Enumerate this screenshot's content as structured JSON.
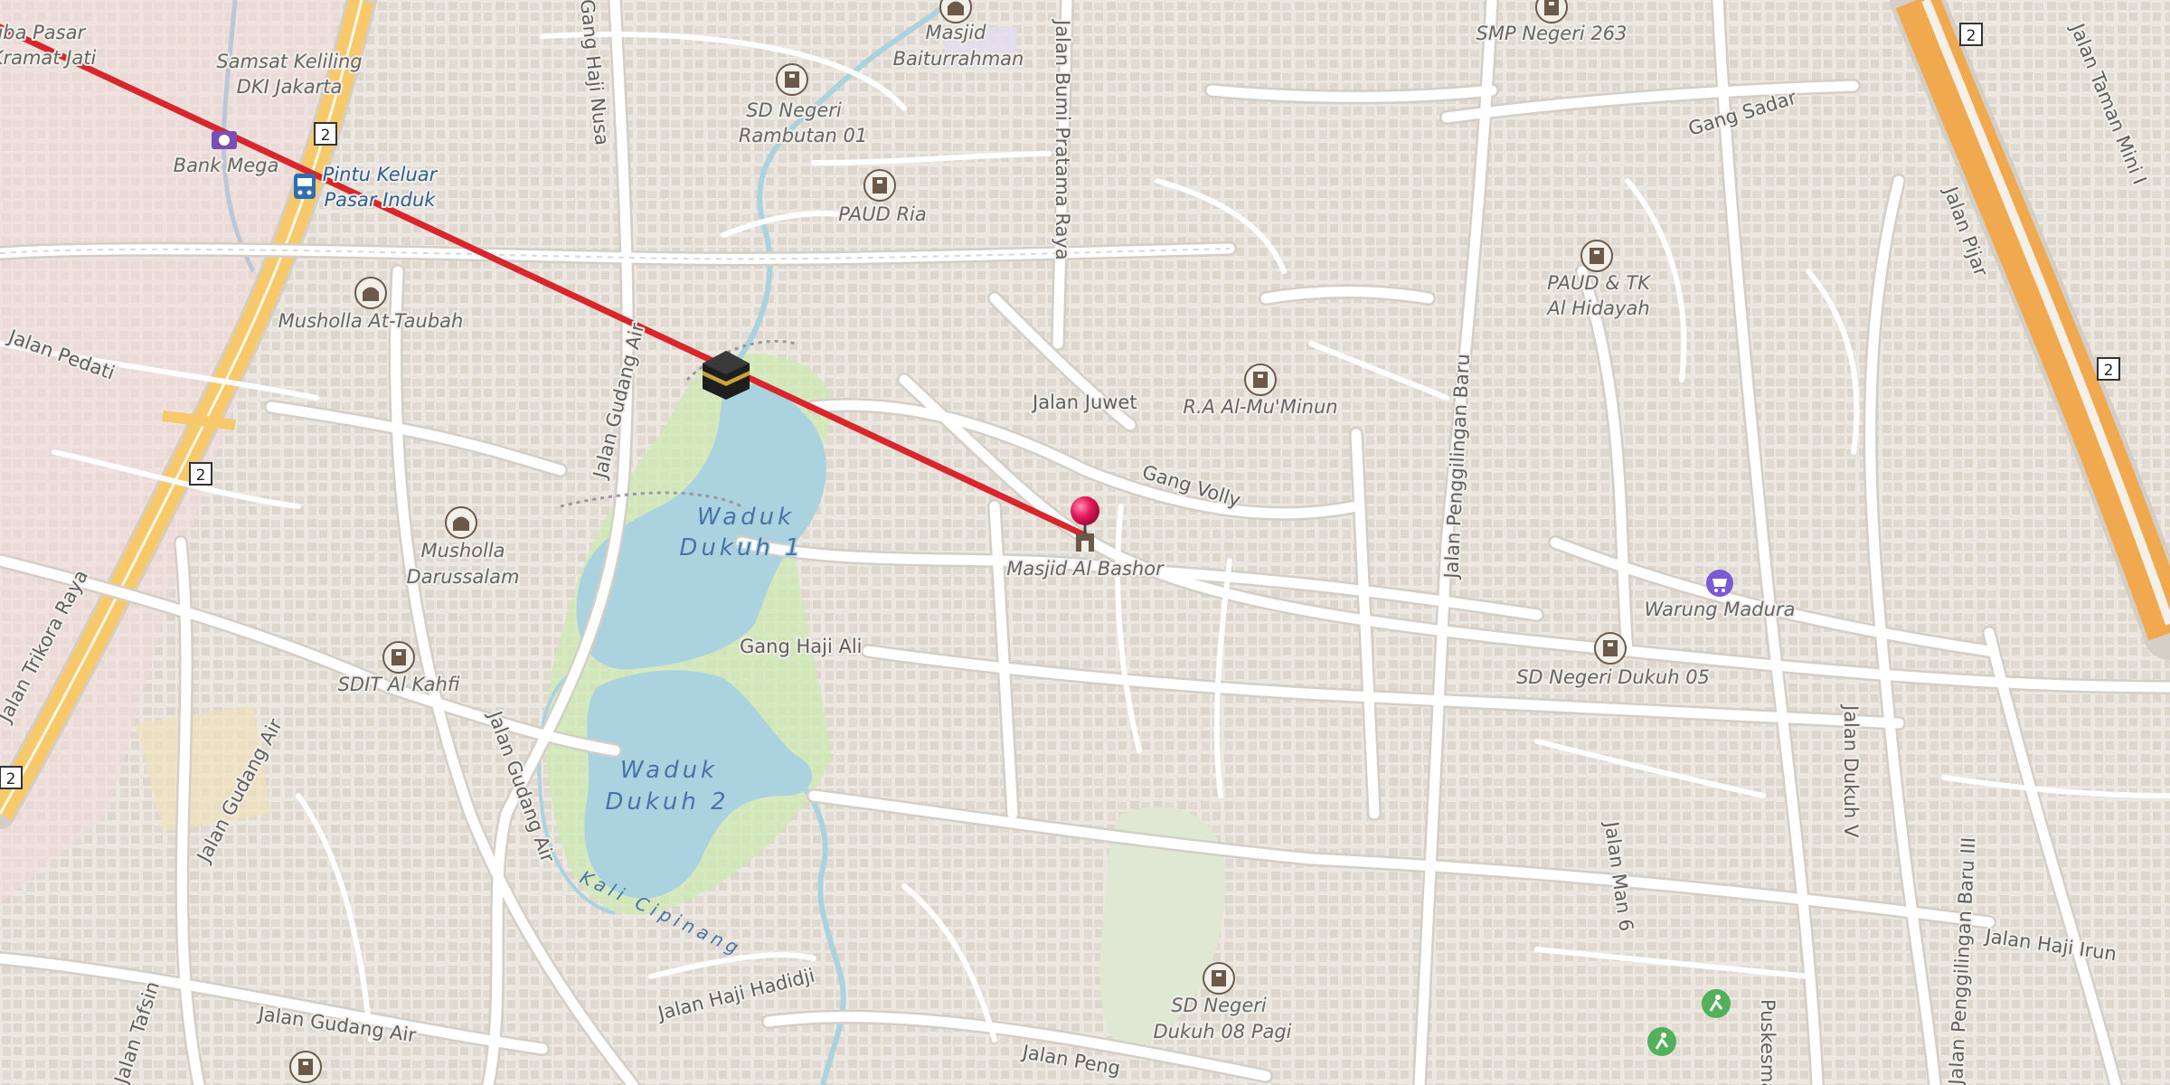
{
  "map": {
    "labels": {
      "pasar_a": "gba Pasar",
      "pasar_b": "Kramat Jati",
      "samsat_a": "Samsat Keliling",
      "samsat_b": "DKI Jakarta",
      "bank_mega": "Bank Mega",
      "pintu_a": "Pintu Keluar",
      "pintu_b": "Pasar Induk",
      "gang_haji_nusa": "Gang Haji Nusa",
      "masjid_bait_a": "Masjid",
      "masjid_bait_b": "Baiturrahman",
      "sd_rambutan_a": "SD Negeri",
      "sd_rambutan_b": "Rambutan 01",
      "paud_ria": "PAUD Ria",
      "jalan_bumi": "Jalan Bumi Pratama Raya",
      "smp_263": "SMP Negeri 263",
      "gang_sadar": "Gang Sadar",
      "jalan_taman_mini": "Jalan Taman Mini I",
      "jalan_pijar": "Jalan Pijar",
      "paud_tk_a": "PAUD & TK",
      "paud_tk_b": "Al Hidayah",
      "musholla_taubah": "Musholla At-Taubah",
      "jalan_pedati": "Jalan Pedati",
      "jalan_gudang_air_n": "Jalan Gudang Air",
      "jalan_juwet": "Jalan Juwet",
      "ra_muminun": "R.A Al-Mu'Minun",
      "jalan_penggilingan_baru": "Jalan Penggilingan Baru",
      "gang_volly": "Gang Volly",
      "waduk1_a": "Waduk",
      "waduk1_b": "Dukuh 1",
      "musholla_darus_a": "Musholla",
      "musholla_darus_b": "Darussalam",
      "masjid_al_bashor": "Masjid Al Bashor",
      "warung_madura": "Warung Madura",
      "jalan_trikora": "Jalan Trikora Raya",
      "sdit_kahfi": "SDIT Al Kahfi",
      "gang_haji_ali": "Gang Haji Ali",
      "sd_dukuh05": "SD Negeri Dukuh 05",
      "jalan_gudang_air_w": "Jalan Gudang Air",
      "jalan_gudang_air_c": "Jalan Gudang Air",
      "waduk2_a": "Waduk",
      "waduk2_b": "Dukuh 2",
      "kali_cipinang": "Kali Cipinang",
      "jalan_dukuh_v": "Jalan Dukuh V",
      "jalan_man6": "Jalan Man 6",
      "jalan_penggilingan_baru_iii": "Jalan Penggilingan Baru III",
      "jalan_haji_irun": "Jalan Haji Irun",
      "jalan_haji_hadidji": "Jalan Haji Hadidji",
      "sd_dukuh08_a": "SD Negeri",
      "sd_dukuh08_b": "Dukuh 08 Pagi",
      "jalan_gudang_air_s": "Jalan Gudang Air",
      "jalan_tafsin": "Jalan Tafsin",
      "jalan_peng": "Jalan Peng",
      "puskesmas": "Puskesmas"
    },
    "route_shields": [
      "2",
      "2",
      "2",
      "2",
      "2"
    ],
    "icons": {
      "kaaba": "kaaba-icon",
      "pin": "location-pin-icon",
      "school": "school-icon",
      "mosque": "mosque-icon",
      "shop": "shop-icon",
      "bus": "bus-stop-icon",
      "bank": "bank-icon",
      "sport": "sports-icon"
    },
    "colors": {
      "background": "#f2efe9",
      "water": "#aad3df",
      "park": "#cdebb0",
      "primary_road": "#f7c96b",
      "trunk_road": "#f0a94f",
      "qibla_line": "#d9262d",
      "pin": "#e8185a"
    }
  }
}
